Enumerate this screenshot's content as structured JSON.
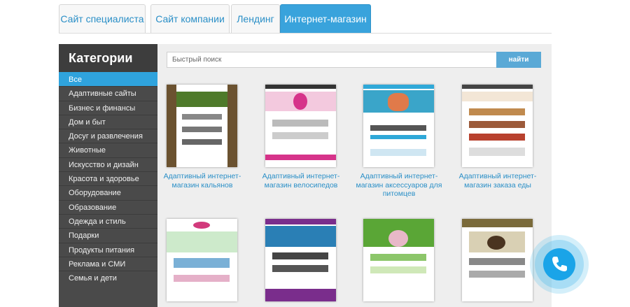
{
  "tabs": [
    {
      "label": "Сайт специалиста"
    },
    {
      "label": "Сайт компании"
    },
    {
      "label": "Лендинг"
    },
    {
      "label": "Интернет-магазин",
      "active": true
    }
  ],
  "sidebar": {
    "title": "Категории",
    "items": [
      {
        "label": "Все",
        "active": true
      },
      {
        "label": "Адаптивные сайты"
      },
      {
        "label": "Бизнес и финансы"
      },
      {
        "label": "Дом и быт"
      },
      {
        "label": "Досуг и развлечения"
      },
      {
        "label": "Животные"
      },
      {
        "label": "Искусство и дизайн"
      },
      {
        "label": "Красота и здоровье"
      },
      {
        "label": "Оборудование"
      },
      {
        "label": "Образование"
      },
      {
        "label": "Одежда и стиль"
      },
      {
        "label": "Подарки"
      },
      {
        "label": "Продукты питания"
      },
      {
        "label": "Реклама и СМИ"
      },
      {
        "label": "Семья и дети"
      }
    ]
  },
  "search": {
    "placeholder": "Быстрый поиск",
    "button_label": "найти"
  },
  "templates": [
    {
      "label": "Адаптивный интернет-магазин кальянов",
      "accent": "#5c4a2e"
    },
    {
      "label": "Адаптивный интернет-магазин велосипедов",
      "accent": "#d6338a"
    },
    {
      "label": "Адаптивный интернет-магазин аксессуаров для питомцев",
      "accent": "#2fa8d8"
    },
    {
      "label": "Адаптивный интернет-магазин заказа еды",
      "accent": "#b8412e"
    },
    {
      "label": "",
      "accent": "#d23a7c"
    },
    {
      "label": "",
      "accent": "#7a2d8c"
    },
    {
      "label": "",
      "accent": "#5aa636"
    },
    {
      "label": "",
      "accent": "#7a6a3a"
    }
  ],
  "colors": {
    "accent": "#39a3dc",
    "sidebar_bg": "#4a4a4a",
    "call_button": "#1aa4e8"
  },
  "icons": {
    "call": "phone-icon"
  }
}
